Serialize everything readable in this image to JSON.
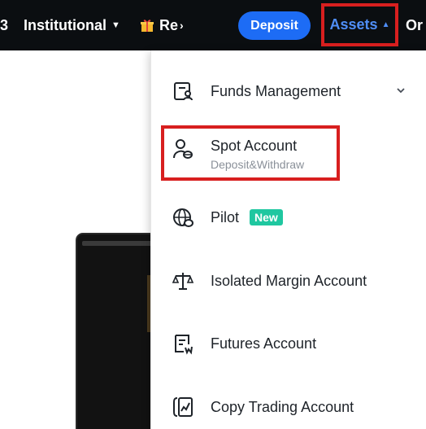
{
  "topnav": {
    "partial_label": "3",
    "institutional_label": "Institutional",
    "institutional_caret": "▼",
    "rewards_label": "Re",
    "rewards_chevron": "›",
    "deposit_label": "Deposit",
    "assets_label": "Assets",
    "assets_caret": "▲",
    "orders_label": "Or"
  },
  "menu": {
    "items": [
      {
        "label": "Funds Management",
        "icon": "wallet-person-icon"
      },
      {
        "label": "Spot Account",
        "sublabel": "Deposit&Withdraw",
        "icon": "user-coin-icon"
      },
      {
        "label": "Pilot",
        "badge": "New",
        "icon": "globe-coin-icon"
      },
      {
        "label": "Isolated Margin Account",
        "icon": "scale-icon"
      },
      {
        "label": "Futures Account",
        "icon": "contract-icon"
      },
      {
        "label": "Copy Trading Account",
        "icon": "chart-bracket-icon"
      }
    ]
  },
  "colors": {
    "topbar_bg": "#0b0e11",
    "deposit_button": "#1d6cf5",
    "assets_text": "#4f8ef7",
    "highlight_border": "#d81f1f",
    "new_badge": "#1fc7a0"
  }
}
